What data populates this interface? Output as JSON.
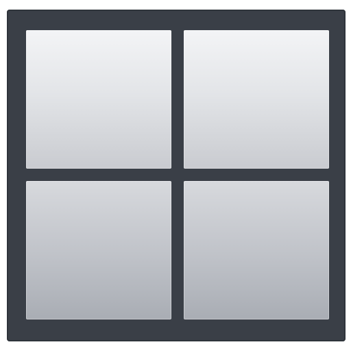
{
  "icon": {
    "name": "grid-2x2-icon",
    "frame_color": "#3a3f47",
    "pane_color_top": "#e3e5e8",
    "pane_color_bottom": "#bfc2c8"
  }
}
